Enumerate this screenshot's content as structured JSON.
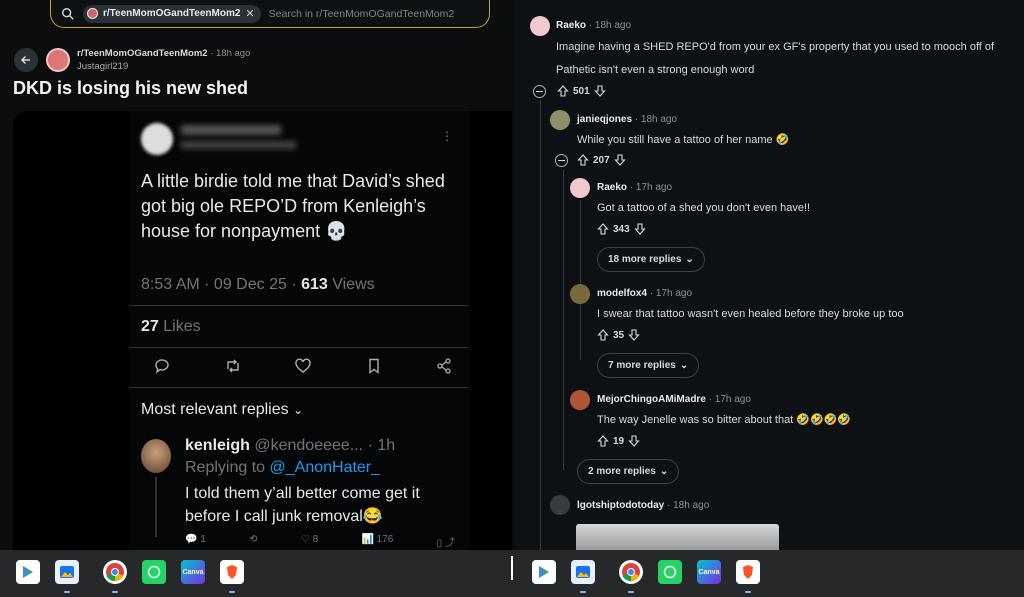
{
  "search": {
    "community_chip": "r/TeenMomOGandTeenMom2",
    "placeholder": "Search in r/TeenMomOGandTeenMom2"
  },
  "post": {
    "subreddit": "r/TeenMomOGandTeenMom2",
    "time": "18h ago",
    "author": "Justagirl219",
    "title": "DKD is losing his new shed"
  },
  "tweet": {
    "text": "A little birdie told me that David’s shed got big ole REPO’D from Kenleigh’s house for nonpayment 💀",
    "time": "8:53 AM · 09 Dec 25 · ",
    "views_count": "613",
    "views_label": " Views",
    "likes_count": "27",
    "likes_label": " Likes",
    "replies_header": "Most relevant replies",
    "reply": {
      "name": "kenleigh",
      "handle": "@kendoeeee... · 1h",
      "replying_prefix": "Replying to ",
      "replying_to": "@_AnonHater_",
      "text": "I told them y’all better come get it before I call junk removal😂",
      "reply_count": "1",
      "like_count": "8",
      "view_count": "176"
    }
  },
  "comments": [
    {
      "user": "Raeko",
      "time": " · 18h ago",
      "lines": [
        "Imagine having a SHED REPO'd from your ex GF's property that you used to mooch off of",
        "Pathetic isn't even a strong enough word"
      ],
      "votes": "501"
    },
    {
      "user": "janieqjones",
      "time": " · 18h ago",
      "lines": [
        "While you still have a tattoo of her name 🤣"
      ],
      "votes": "207"
    },
    {
      "user": "Raeko",
      "time": " · 17h ago",
      "lines": [
        "Got a tattoo of a shed you don't even have!!"
      ],
      "votes": "343",
      "more": "18 more replies"
    },
    {
      "user": "modelfox4",
      "time": " · 17h ago",
      "lines": [
        "I swear that tattoo wasn't even healed before they broke up too"
      ],
      "votes": "35",
      "more": "7 more replies"
    },
    {
      "user": "MejorChingoAMiMadre",
      "time": " · 17h ago",
      "lines": [
        "The way Jenelle was so bitter about that 🤣🤣🤣🤣"
      ],
      "votes": "19"
    },
    {
      "user": "lgotshiptodotoday",
      "time": " · 18h ago",
      "lines": [],
      "votes": ""
    }
  ],
  "more_replies_outer": "2 more replies",
  "taskbar": {
    "canva_label": "Canva",
    "apps": [
      "play-store",
      "gallery",
      "chrome",
      "whatsapp",
      "canva",
      "brave"
    ]
  },
  "colors": {
    "search_outline": "#c9a227",
    "link_blue": "#1d9bf0"
  }
}
